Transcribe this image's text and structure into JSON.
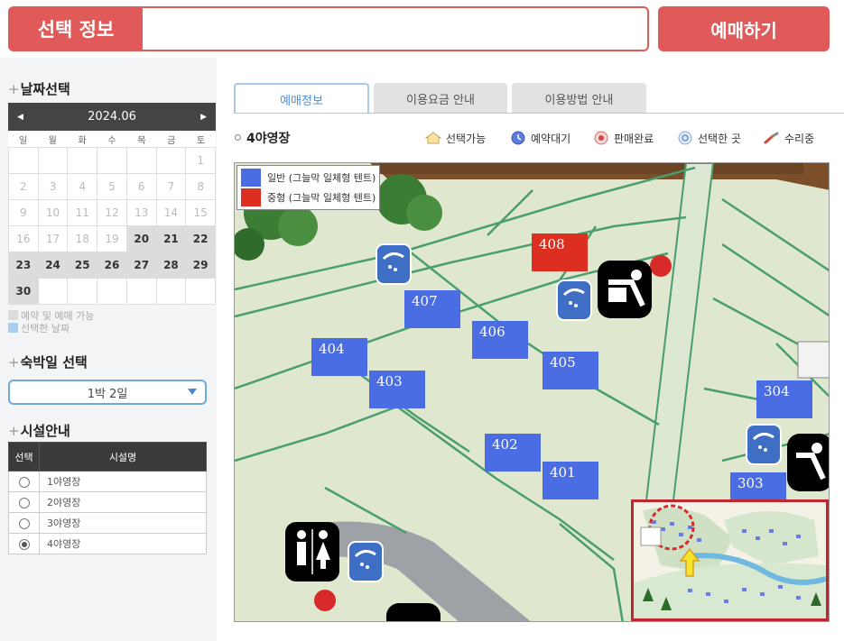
{
  "topbar": {
    "label": "선택 정보",
    "input_value": "",
    "book_button": "예매하기"
  },
  "date_section": {
    "title": "날짜선택",
    "month": "2024.06",
    "prev_icon": "chevron-left-icon",
    "next_icon": "chevron-right-icon",
    "weekdays": [
      "일",
      "월",
      "화",
      "수",
      "목",
      "금",
      "토"
    ],
    "weeks": [
      [
        "",
        "",
        "",
        "",
        "",
        "",
        "1"
      ],
      [
        "2",
        "3",
        "4",
        "5",
        "6",
        "7",
        "8"
      ],
      [
        "9",
        "10",
        "11",
        "12",
        "13",
        "14",
        "15"
      ],
      [
        "16",
        "17",
        "18",
        "19",
        "20",
        "21",
        "22"
      ],
      [
        "23",
        "24",
        "25",
        "26",
        "27",
        "28",
        "29"
      ],
      [
        "30",
        "",
        "",
        "",
        "",
        "",
        ""
      ]
    ],
    "available_days": [
      "20",
      "21",
      "22",
      "23",
      "24",
      "25",
      "26",
      "27",
      "28",
      "29",
      "30"
    ],
    "legend_available": "예약 및 예매 가능",
    "legend_selected": "선택한 날짜",
    "colors": {
      "available": "#dcdcdc",
      "selected": "#a9cdf0"
    }
  },
  "stay_section": {
    "title": "숙박일 선택",
    "selected": "1박 2일"
  },
  "facility_section": {
    "title": "시설안내",
    "col_select": "선택",
    "col_name": "시설명",
    "rows": [
      {
        "name": "1야영장",
        "selected": false
      },
      {
        "name": "2야영장",
        "selected": false
      },
      {
        "name": "3야영장",
        "selected": false
      },
      {
        "name": "4야영장",
        "selected": true
      }
    ]
  },
  "tabs": [
    {
      "label": "예매정보",
      "active": true
    },
    {
      "label": "이용요금 안내",
      "active": false
    },
    {
      "label": "이용방법 안내",
      "active": false
    }
  ],
  "site_title": "4야영장",
  "status_legend": [
    {
      "label": "선택가능",
      "icon": "house-icon"
    },
    {
      "label": "예약대기",
      "icon": "clock-icon"
    },
    {
      "label": "판매완료",
      "icon": "sold-out-icon"
    },
    {
      "label": "선택한 곳",
      "icon": "selected-spot-icon"
    },
    {
      "label": "수리중",
      "icon": "wrench-icon"
    }
  ],
  "map": {
    "legend": [
      {
        "label": "일반 (그늘막 일체형 텐트)",
        "color": "#4a6de4"
      },
      {
        "label": "중형 (그늘막 일체형 텐트)",
        "color": "#dc2f22"
      }
    ],
    "sites": [
      {
        "id": "408",
        "type": "red"
      },
      {
        "id": "407",
        "type": "blue"
      },
      {
        "id": "406",
        "type": "blue"
      },
      {
        "id": "405",
        "type": "blue"
      },
      {
        "id": "404",
        "type": "blue"
      },
      {
        "id": "403",
        "type": "blue"
      },
      {
        "id": "402",
        "type": "blue"
      },
      {
        "id": "401",
        "type": "blue"
      },
      {
        "id": "304",
        "type": "blue"
      },
      {
        "id": "303",
        "type": "blue"
      }
    ],
    "icons": [
      "shower-icon",
      "shower-icon",
      "sink-icon",
      "toilet-icon",
      "shower-icon",
      "sink-icon"
    ]
  }
}
